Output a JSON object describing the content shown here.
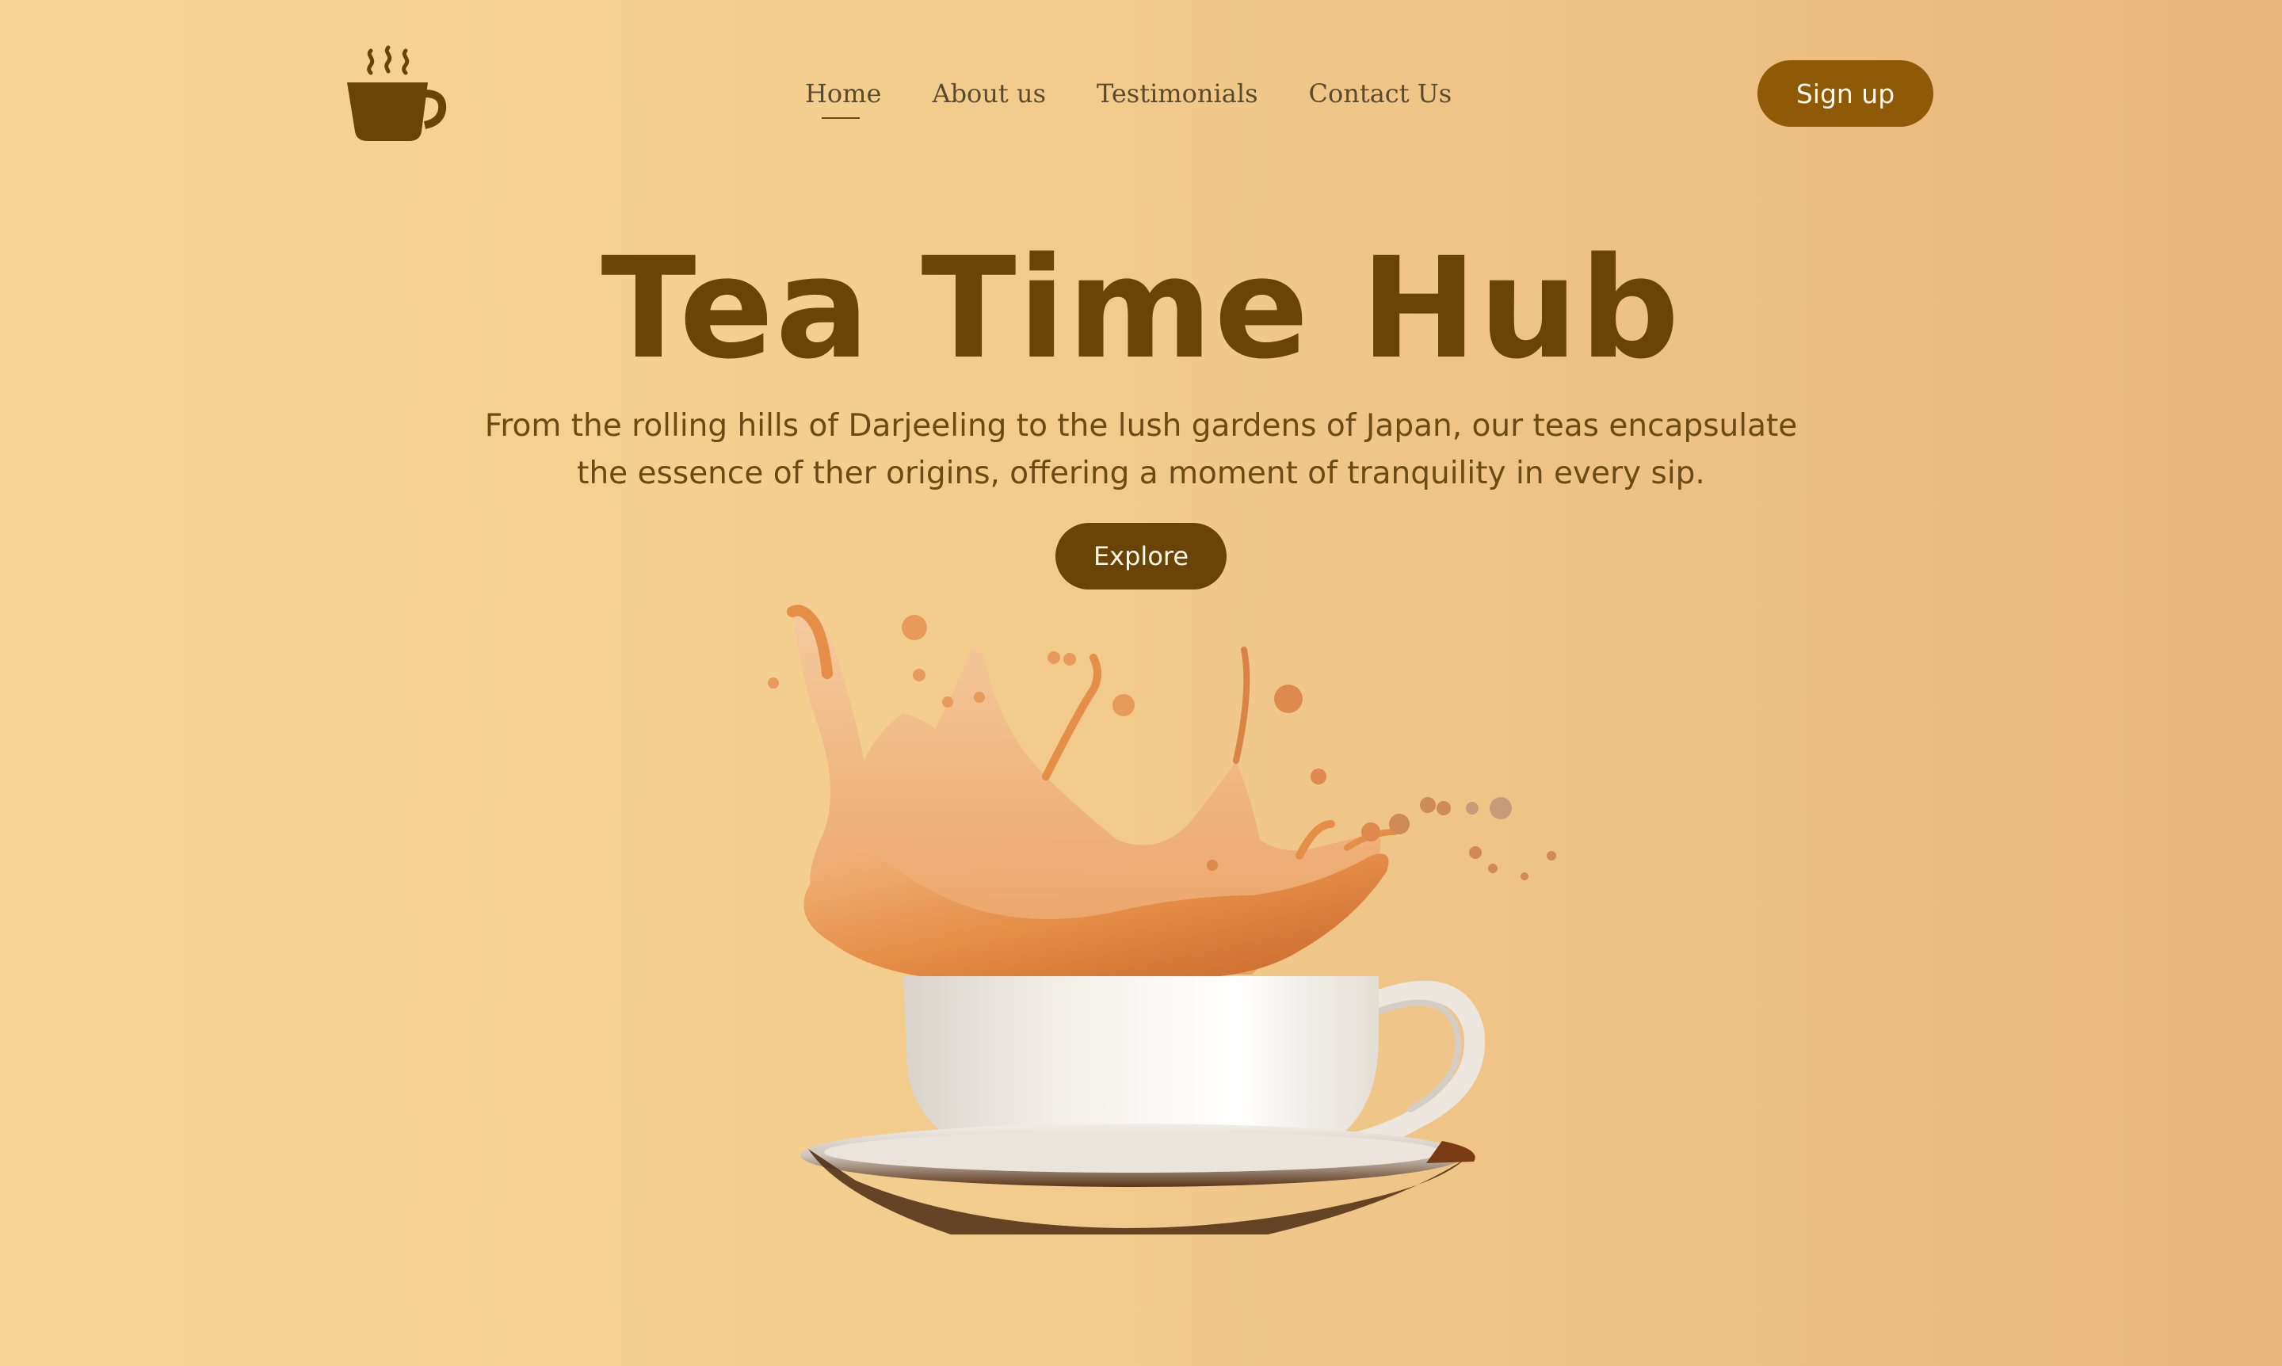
{
  "header": {
    "logo_icon": "tea-cup-icon",
    "nav": [
      {
        "label": "Home",
        "active": true
      },
      {
        "label": "About us",
        "active": false
      },
      {
        "label": "Testimonials",
        "active": false
      },
      {
        "label": "Contact Us",
        "active": false
      }
    ],
    "signup_label": "Sign up"
  },
  "hero": {
    "title": "Tea Time Hub",
    "subtitle_line1": "From the rolling hills of Darjeeling to the lush gardens of Japan, our teas encapsulate",
    "subtitle_line2": "the essence of ther origins, offering a moment of tranquility in every sip.",
    "explore_label": "Explore",
    "image_icon": "tea-splash-cup-image"
  },
  "colors": {
    "background_start": "#f8d594",
    "background_end": "#e8b77b",
    "primary_brown": "#6a4407",
    "signup_brown": "#8f5a08",
    "nav_text": "#5a4a2f"
  }
}
